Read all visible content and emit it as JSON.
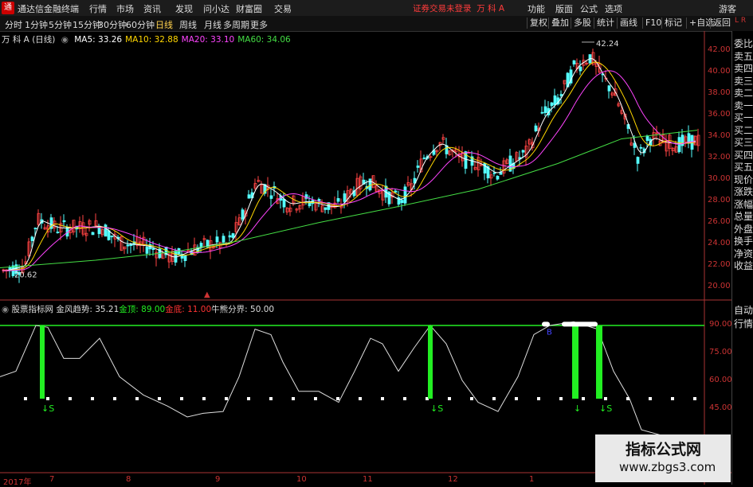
{
  "app": {
    "title": "通达信金融终端",
    "login_status": "证券交易未登录",
    "stock_label": "万 科 A"
  },
  "menu": [
    "行情",
    "市场",
    "资讯",
    "发现",
    "问小达",
    "财富圈",
    "交易"
  ],
  "right_menu": [
    "功能",
    "版面",
    "公式",
    "选项",
    "游客"
  ],
  "toolbar": {
    "periods": [
      "分时",
      "1分钟",
      "5分钟",
      "15分钟",
      "30分钟",
      "60分钟",
      "日线",
      "周线",
      "月线",
      "多周期",
      "更多"
    ],
    "active": "日线",
    "right_buttons": [
      "复权",
      "叠加",
      "多股",
      "统计",
      "画线",
      "F10",
      "标记",
      "+自选",
      "返回"
    ]
  },
  "main_chart": {
    "stock": "万 科 A (日线)",
    "ma": [
      {
        "name": "MA5",
        "value": "33.26",
        "color": "#ffffff"
      },
      {
        "name": "MA10",
        "value": "32.88",
        "color": "#ffd700"
      },
      {
        "name": "MA20",
        "value": "33.10",
        "color": "#ff44ff"
      },
      {
        "name": "MA60",
        "value": "34.06",
        "color": "#44dd44"
      }
    ],
    "high_label": "42.24",
    "low_label": "20.62",
    "y_ticks": [
      "42.00",
      "40.00",
      "38.00",
      "36.00",
      "34.00",
      "32.00",
      "30.00",
      "28.00",
      "26.00",
      "24.00",
      "22.00",
      "20.00"
    ]
  },
  "indicator": {
    "name": "股票指标网",
    "items": [
      {
        "label": "金风趋势: 35.21",
        "color": "#dddddd"
      },
      {
        "label": "金顶: 89.00",
        "color": "#22ee22"
      },
      {
        "label": "金底: 11.00",
        "color": "#ff3333"
      },
      {
        "label": "牛熊分界: 50.00",
        "color": "#dddddd"
      }
    ],
    "y_ticks": [
      "90.00",
      "75.00",
      "60.00",
      "45.00"
    ]
  },
  "x_labels": [
    "2017年",
    "7",
    "8",
    "9",
    "10",
    "11",
    "12",
    "1"
  ],
  "side_panel": [
    "委比",
    "卖五",
    "卖四",
    "卖三",
    "卖二",
    "卖一",
    "买一",
    "买二",
    "买三",
    "买四",
    "买五",
    "现价",
    "涨跌",
    "涨幅",
    "总量",
    "外盘",
    "换手",
    "净资",
    "收益",
    "自动",
    "行情"
  ],
  "watermark": {
    "title": "指标公式网",
    "url": "www.zbgs3.com"
  }
}
